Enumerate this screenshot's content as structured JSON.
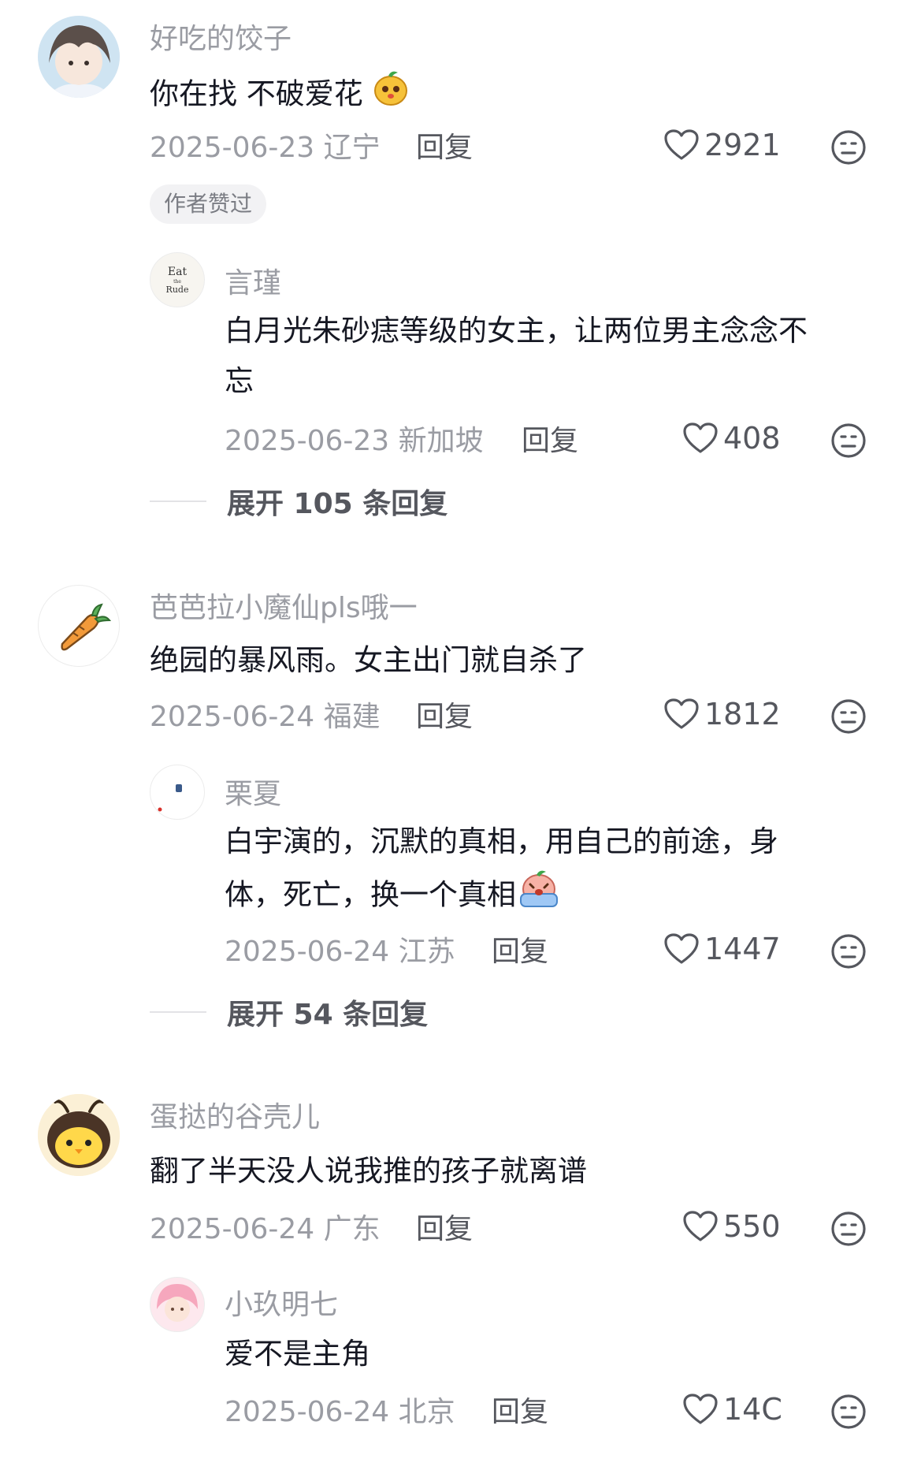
{
  "comments": [
    {
      "username": "好吃的饺子",
      "text": "你在找 不破爱花",
      "date_location": "2025-06-23 辽宁",
      "reply_label": "回复",
      "likes": "2921",
      "badge": "作者赞过",
      "replies": [
        {
          "username": "言瑾",
          "text_line1": "白月光朱砂痣等级的女主，让两位男主念念不",
          "text_line2": "忘",
          "date_location": "2025-06-23 新加坡",
          "reply_label": "回复",
          "likes": "408",
          "avatar_text": "Eat the Rude"
        }
      ],
      "expand_label": "展开 105 条回复"
    },
    {
      "username": "芭芭拉小魔仙pls哦一",
      "text": "绝园的暴风雨。女主出门就自杀了",
      "date_location": "2025-06-24 福建",
      "reply_label": "回复",
      "likes": "1812",
      "replies": [
        {
          "username": "栗夏",
          "text_line1": "白宇演的，沉默的真相，用自己的前途，身",
          "text_line2": "体，死亡，换一个真相",
          "date_location": "2025-06-24 江苏",
          "reply_label": "回复",
          "likes": "1447"
        }
      ],
      "expand_label": "展开 54 条回复"
    },
    {
      "username": "蛋挞的谷壳儿",
      "text": "翻了半天没人说我推的孩子就离谱",
      "date_location": "2025-06-24 广东",
      "reply_label": "回复",
      "likes": "550",
      "replies": [
        {
          "username": "小玖明七",
          "text_line1": "爱不是主角",
          "date_location": "2025-06-24 北京",
          "reply_label": "回复",
          "likes": "14C"
        }
      ]
    }
  ],
  "colors": {
    "text": "#161823",
    "muted": "#9a9ca3",
    "action": "#55575e",
    "badge_bg": "#f2f2f4"
  },
  "icons": {
    "like": "heart-outline-icon",
    "dislike": "meh-face-icon"
  }
}
